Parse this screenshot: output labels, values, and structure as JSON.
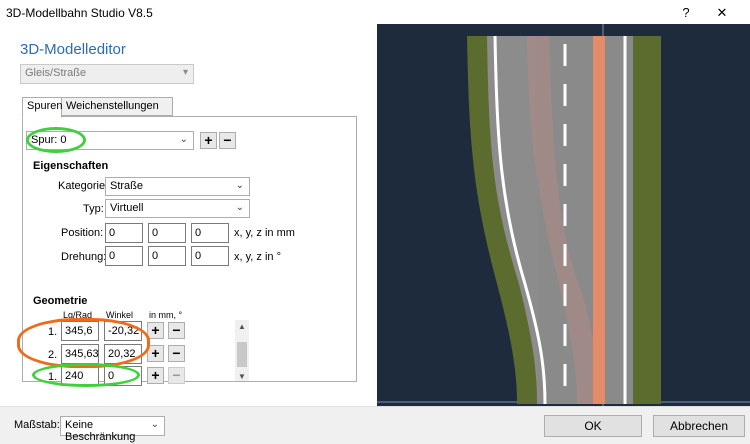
{
  "window": {
    "title": "3D-Modellbahn Studio V8.5",
    "help_glyph": "?",
    "close_glyph": "✕"
  },
  "editor": {
    "title": "3D-Modelleditor",
    "type_select": "Gleis/Straße"
  },
  "tabs": [
    {
      "label": "Spuren",
      "active": true
    },
    {
      "label": "Weichenstellungen",
      "active": false
    }
  ],
  "spur": {
    "selected": "Spur: 0",
    "add_label": "+",
    "remove_label": "−"
  },
  "eigenschaften": {
    "heading": "Eigenschaften",
    "kategorie_label": "Kategorie:",
    "kategorie_value": "Straße",
    "typ_label": "Typ:",
    "typ_value": "Virtuell",
    "position_label": "Position:",
    "position_values": [
      "0",
      "0",
      "0"
    ],
    "position_unit": "x, y, z in mm",
    "drehung_label": "Drehung:",
    "drehung_values": [
      "0",
      "0",
      "0"
    ],
    "drehung_unit": "x, y, z in °"
  },
  "geometrie": {
    "heading": "Geometrie",
    "col_lg_rad": "Lg/Rad",
    "col_winkel": "Winkel",
    "col_unit": "in mm, °",
    "rows": [
      {
        "index": "1.",
        "length": "345,6",
        "angle": "-20,32"
      },
      {
        "index": "2.",
        "length": "345,63",
        "angle": "20,32"
      },
      {
        "index": "1.",
        "length": "240",
        "angle": "0"
      }
    ],
    "plus": "+",
    "minus": "−"
  },
  "footer": {
    "massstab_label": "Maßstab:",
    "massstab_value": "Keine Beschränkung",
    "ok_label": "OK",
    "cancel_label": "Abbrechen"
  },
  "colors": {
    "accent_title": "#2b6cb5",
    "annotation_green": "#3fd13a",
    "annotation_orange": "#f06a1c",
    "viewport_bg": "#1d2b3d",
    "grass": "#5c6b2e",
    "asphalt": "#8a8a8a",
    "track_orange": "#e48c6a"
  }
}
